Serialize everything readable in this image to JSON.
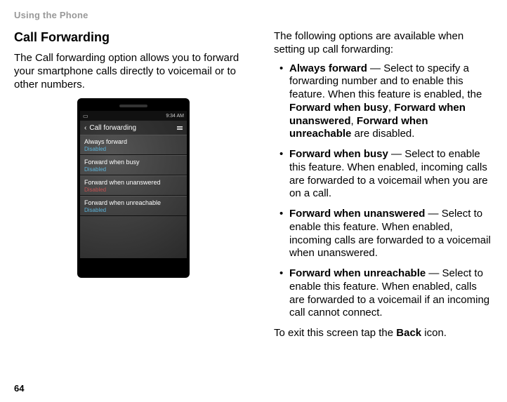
{
  "header_label": "Using the Phone",
  "section_title": "Call Forwarding",
  "intro": "The Call forwarding option allows you to forward your smartphone calls directly to voicemail or to other numbers.",
  "phone": {
    "status_time": "9:34 AM",
    "screen_title": "Call forwarding",
    "rows": [
      {
        "label": "Always forward",
        "state": "Disabled",
        "style": "blue"
      },
      {
        "label": "Forward when busy",
        "state": "Disabled",
        "style": "blue"
      },
      {
        "label": "Forward when unanswered",
        "state": "Disabled",
        "style": "red"
      },
      {
        "label": "Forward when unreachable",
        "state": "Disabled",
        "style": "blue"
      }
    ]
  },
  "right_intro": "The following options are available when setting up call forwarding:",
  "bullets": [
    {
      "lead": "Always forward",
      "rest": " — Select to specify a forwarding number and to enable this feature. When this feature is enabled, the ",
      "bold_list": [
        "Forward when busy",
        ", ",
        "Forward when unanswered",
        ", ",
        "Forward when unreachable"
      ],
      "tail": " are disabled."
    },
    {
      "lead": "Forward when busy",
      "rest": " — Select to enable this feature. When enabled, incoming calls are forwarded to a voicemail when you are on a call."
    },
    {
      "lead": "Forward when unanswered",
      "rest": " — Select to enable this feature. When enabled, incoming calls are forwarded to a voicemail when unanswered."
    },
    {
      "lead": "Forward when unreachable",
      "rest": " — Select to enable this feature. When enabled, calls are forwarded to a voicemail if an incoming call cannot connect."
    }
  ],
  "closing_pre": "To exit this screen tap the ",
  "closing_bold": "Back",
  "closing_post": " icon.",
  "page_number": "64"
}
